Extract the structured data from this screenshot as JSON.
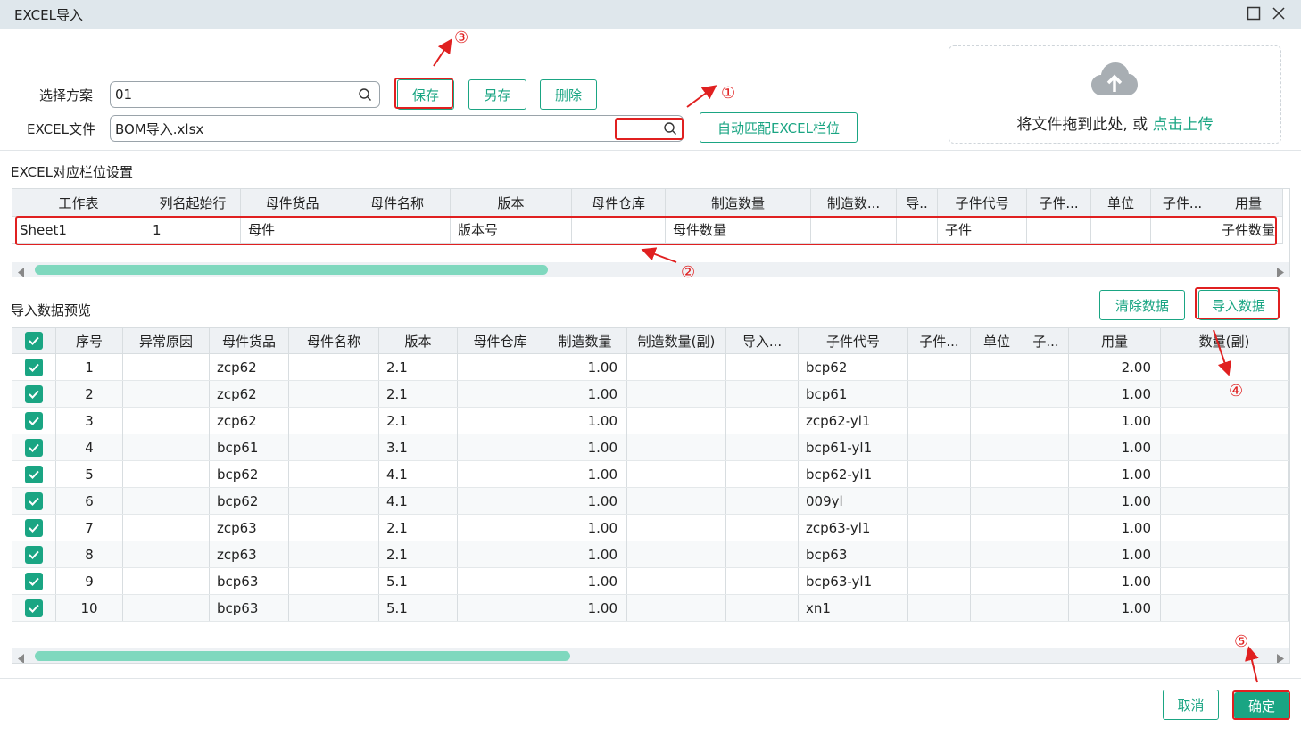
{
  "window": {
    "title": "EXCEL导入"
  },
  "scheme": {
    "label": "选择方案",
    "value": "01",
    "save": "保存",
    "save_as": "另存",
    "delete": "删除"
  },
  "file": {
    "label": "EXCEL文件",
    "value": "BOM导入.xlsx",
    "auto_match": "自动匹配EXCEL栏位"
  },
  "upload": {
    "text": "将文件拖到此处, 或 ",
    "link": "点击上传"
  },
  "mapping": {
    "title": "EXCEL对应栏位设置",
    "headers": [
      "工作表",
      "列名起始行",
      "母件货品",
      "母件名称",
      "版本",
      "母件仓库",
      "制造数量",
      "制造数...",
      "导..",
      "子件代号",
      "子件...",
      "单位",
      "子件...",
      "用量"
    ],
    "row": [
      "Sheet1",
      "1",
      "母件",
      "",
      "版本号",
      "",
      "母件数量",
      "",
      "",
      "子件",
      "",
      "",
      "",
      "子件数量"
    ]
  },
  "preview": {
    "title": "导入数据预览",
    "clear": "清除数据",
    "import": "导入数据",
    "headers": [
      "",
      "序号",
      "异常原因",
      "母件货品",
      "母件名称",
      "版本",
      "母件仓库",
      "制造数量",
      "制造数量(副)",
      "导入...",
      "子件代号",
      "子件...",
      "单位",
      "子...",
      "用量",
      "数量(副)"
    ],
    "rows": [
      [
        "1",
        "",
        "zcp62",
        "",
        "2.1",
        "",
        "1.00",
        "",
        "",
        "bcp62",
        "",
        "",
        "",
        "2.00",
        ""
      ],
      [
        "2",
        "",
        "zcp62",
        "",
        "2.1",
        "",
        "1.00",
        "",
        "",
        "bcp61",
        "",
        "",
        "",
        "1.00",
        ""
      ],
      [
        "3",
        "",
        "zcp62",
        "",
        "2.1",
        "",
        "1.00",
        "",
        "",
        "zcp62-yl1",
        "",
        "",
        "",
        "1.00",
        ""
      ],
      [
        "4",
        "",
        "bcp61",
        "",
        "3.1",
        "",
        "1.00",
        "",
        "",
        "bcp61-yl1",
        "",
        "",
        "",
        "1.00",
        ""
      ],
      [
        "5",
        "",
        "bcp62",
        "",
        "4.1",
        "",
        "1.00",
        "",
        "",
        "bcp62-yl1",
        "",
        "",
        "",
        "1.00",
        ""
      ],
      [
        "6",
        "",
        "bcp62",
        "",
        "4.1",
        "",
        "1.00",
        "",
        "",
        "009yl",
        "",
        "",
        "",
        "1.00",
        ""
      ],
      [
        "7",
        "",
        "zcp63",
        "",
        "2.1",
        "",
        "1.00",
        "",
        "",
        "zcp63-yl1",
        "",
        "",
        "",
        "1.00",
        ""
      ],
      [
        "8",
        "",
        "zcp63",
        "",
        "2.1",
        "",
        "1.00",
        "",
        "",
        "bcp63",
        "",
        "",
        "",
        "1.00",
        ""
      ],
      [
        "9",
        "",
        "bcp63",
        "",
        "5.1",
        "",
        "1.00",
        "",
        "",
        "bcp63-yl1",
        "",
        "",
        "",
        "1.00",
        ""
      ],
      [
        "10",
        "",
        "bcp63",
        "",
        "5.1",
        "",
        "1.00",
        "",
        "",
        "xn1",
        "",
        "",
        "",
        "1.00",
        ""
      ]
    ]
  },
  "footer": {
    "cancel": "取消",
    "confirm": "确定"
  },
  "annotations": [
    "①",
    "②",
    "③",
    "④",
    "⑤"
  ],
  "colors": {
    "accent": "#1aa583",
    "highlight": "#e02020",
    "titlebar": "#dfe7ec"
  }
}
